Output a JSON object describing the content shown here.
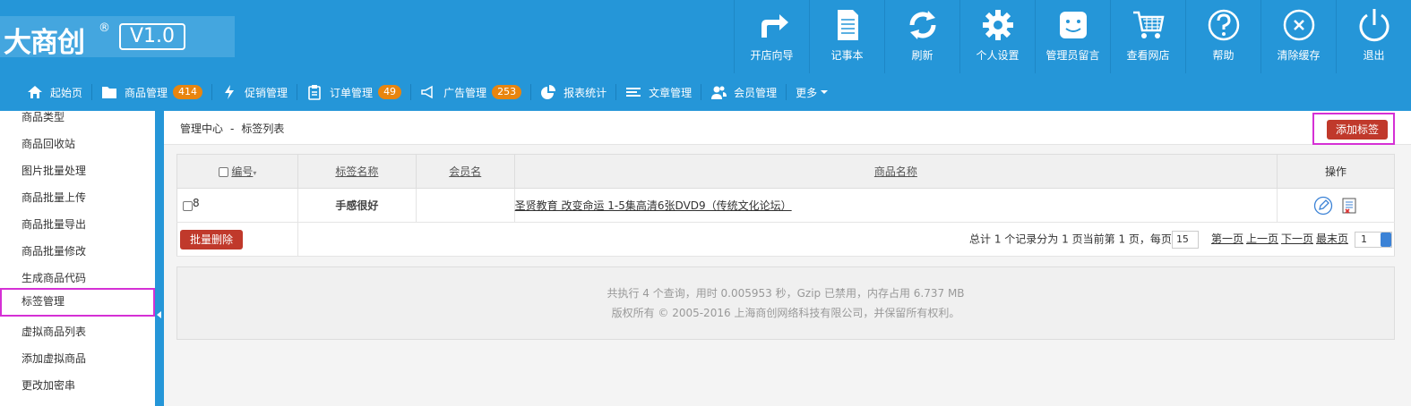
{
  "logo": {
    "text": "大商创",
    "reg": "®",
    "version": "V1.0"
  },
  "topnav": [
    {
      "label": "开店向导",
      "icon": "share-arrow-icon"
    },
    {
      "label": "记事本",
      "icon": "notepad-icon"
    },
    {
      "label": "刷新",
      "icon": "refresh-icon"
    },
    {
      "label": "个人设置",
      "icon": "gear-icon"
    },
    {
      "label": "管理员留言",
      "icon": "message-icon"
    },
    {
      "label": "查看网店",
      "icon": "cart-icon"
    },
    {
      "label": "帮助",
      "icon": "help-icon"
    },
    {
      "label": "清除缓存",
      "icon": "clear-cache-icon"
    },
    {
      "label": "退出",
      "icon": "power-icon"
    }
  ],
  "menu": [
    {
      "label": "起始页",
      "icon": "home-icon",
      "badge": ""
    },
    {
      "label": "商品管理",
      "icon": "folder-icon",
      "badge": "414"
    },
    {
      "label": "促销管理",
      "icon": "lightning-icon",
      "badge": ""
    },
    {
      "label": "订单管理",
      "icon": "clipboard-icon",
      "badge": "49"
    },
    {
      "label": "广告管理",
      "icon": "megaphone-icon",
      "badge": "253"
    },
    {
      "label": "报表统计",
      "icon": "pie-chart-icon",
      "badge": ""
    },
    {
      "label": "文章管理",
      "icon": "list-icon",
      "badge": ""
    },
    {
      "label": "会员管理",
      "icon": "users-icon",
      "badge": ""
    },
    {
      "label": "更多",
      "icon": "",
      "badge": ""
    }
  ],
  "sidebar": {
    "items": [
      "商品类型",
      "商品回收站",
      "图片批量处理",
      "商品批量上传",
      "商品批量导出",
      "商品批量修改",
      "生成商品代码",
      "标签管理",
      "虚拟商品列表",
      "添加虚拟商品",
      "更改加密串"
    ],
    "active": "标签管理"
  },
  "breadcrumb": {
    "root": "管理中心",
    "sep": "-",
    "current": "标签列表"
  },
  "add_button": "添加标签",
  "table": {
    "headers": {
      "id": "编号",
      "tag": "标签名称",
      "member": "会员名",
      "goods": "商品名称",
      "ops": "操作"
    },
    "rows": [
      {
        "id": "8",
        "tag": "手感很好",
        "member": "",
        "goods": "圣贤教育 改变命运 1-5集高清6张DVD9（传统文化论坛）"
      }
    ],
    "bulk_delete": "批量删除"
  },
  "pager": {
    "summary_a": "总计",
    "total": "1",
    "summary_b": "个记录分为",
    "pages": "1",
    "summary_c": "页当前第",
    "current": "1",
    "summary_d": "页，每页",
    "per_page": "15",
    "first": "第一页",
    "prev": "上一页",
    "next": "下一页",
    "last": "最末页",
    "jump": "1"
  },
  "footer": {
    "line1": "共执行 4 个查询，用时 0.005953 秒，Gzip 已禁用，内存占用 6.737 MB",
    "line2": "版权所有 © 2005-2016 上海商创网络科技有限公司，并保留所有权利。"
  },
  "colors": {
    "header": "#2596d8",
    "badge": "#e8850f",
    "danger": "#c0392b",
    "highlight": "#d530d5"
  }
}
